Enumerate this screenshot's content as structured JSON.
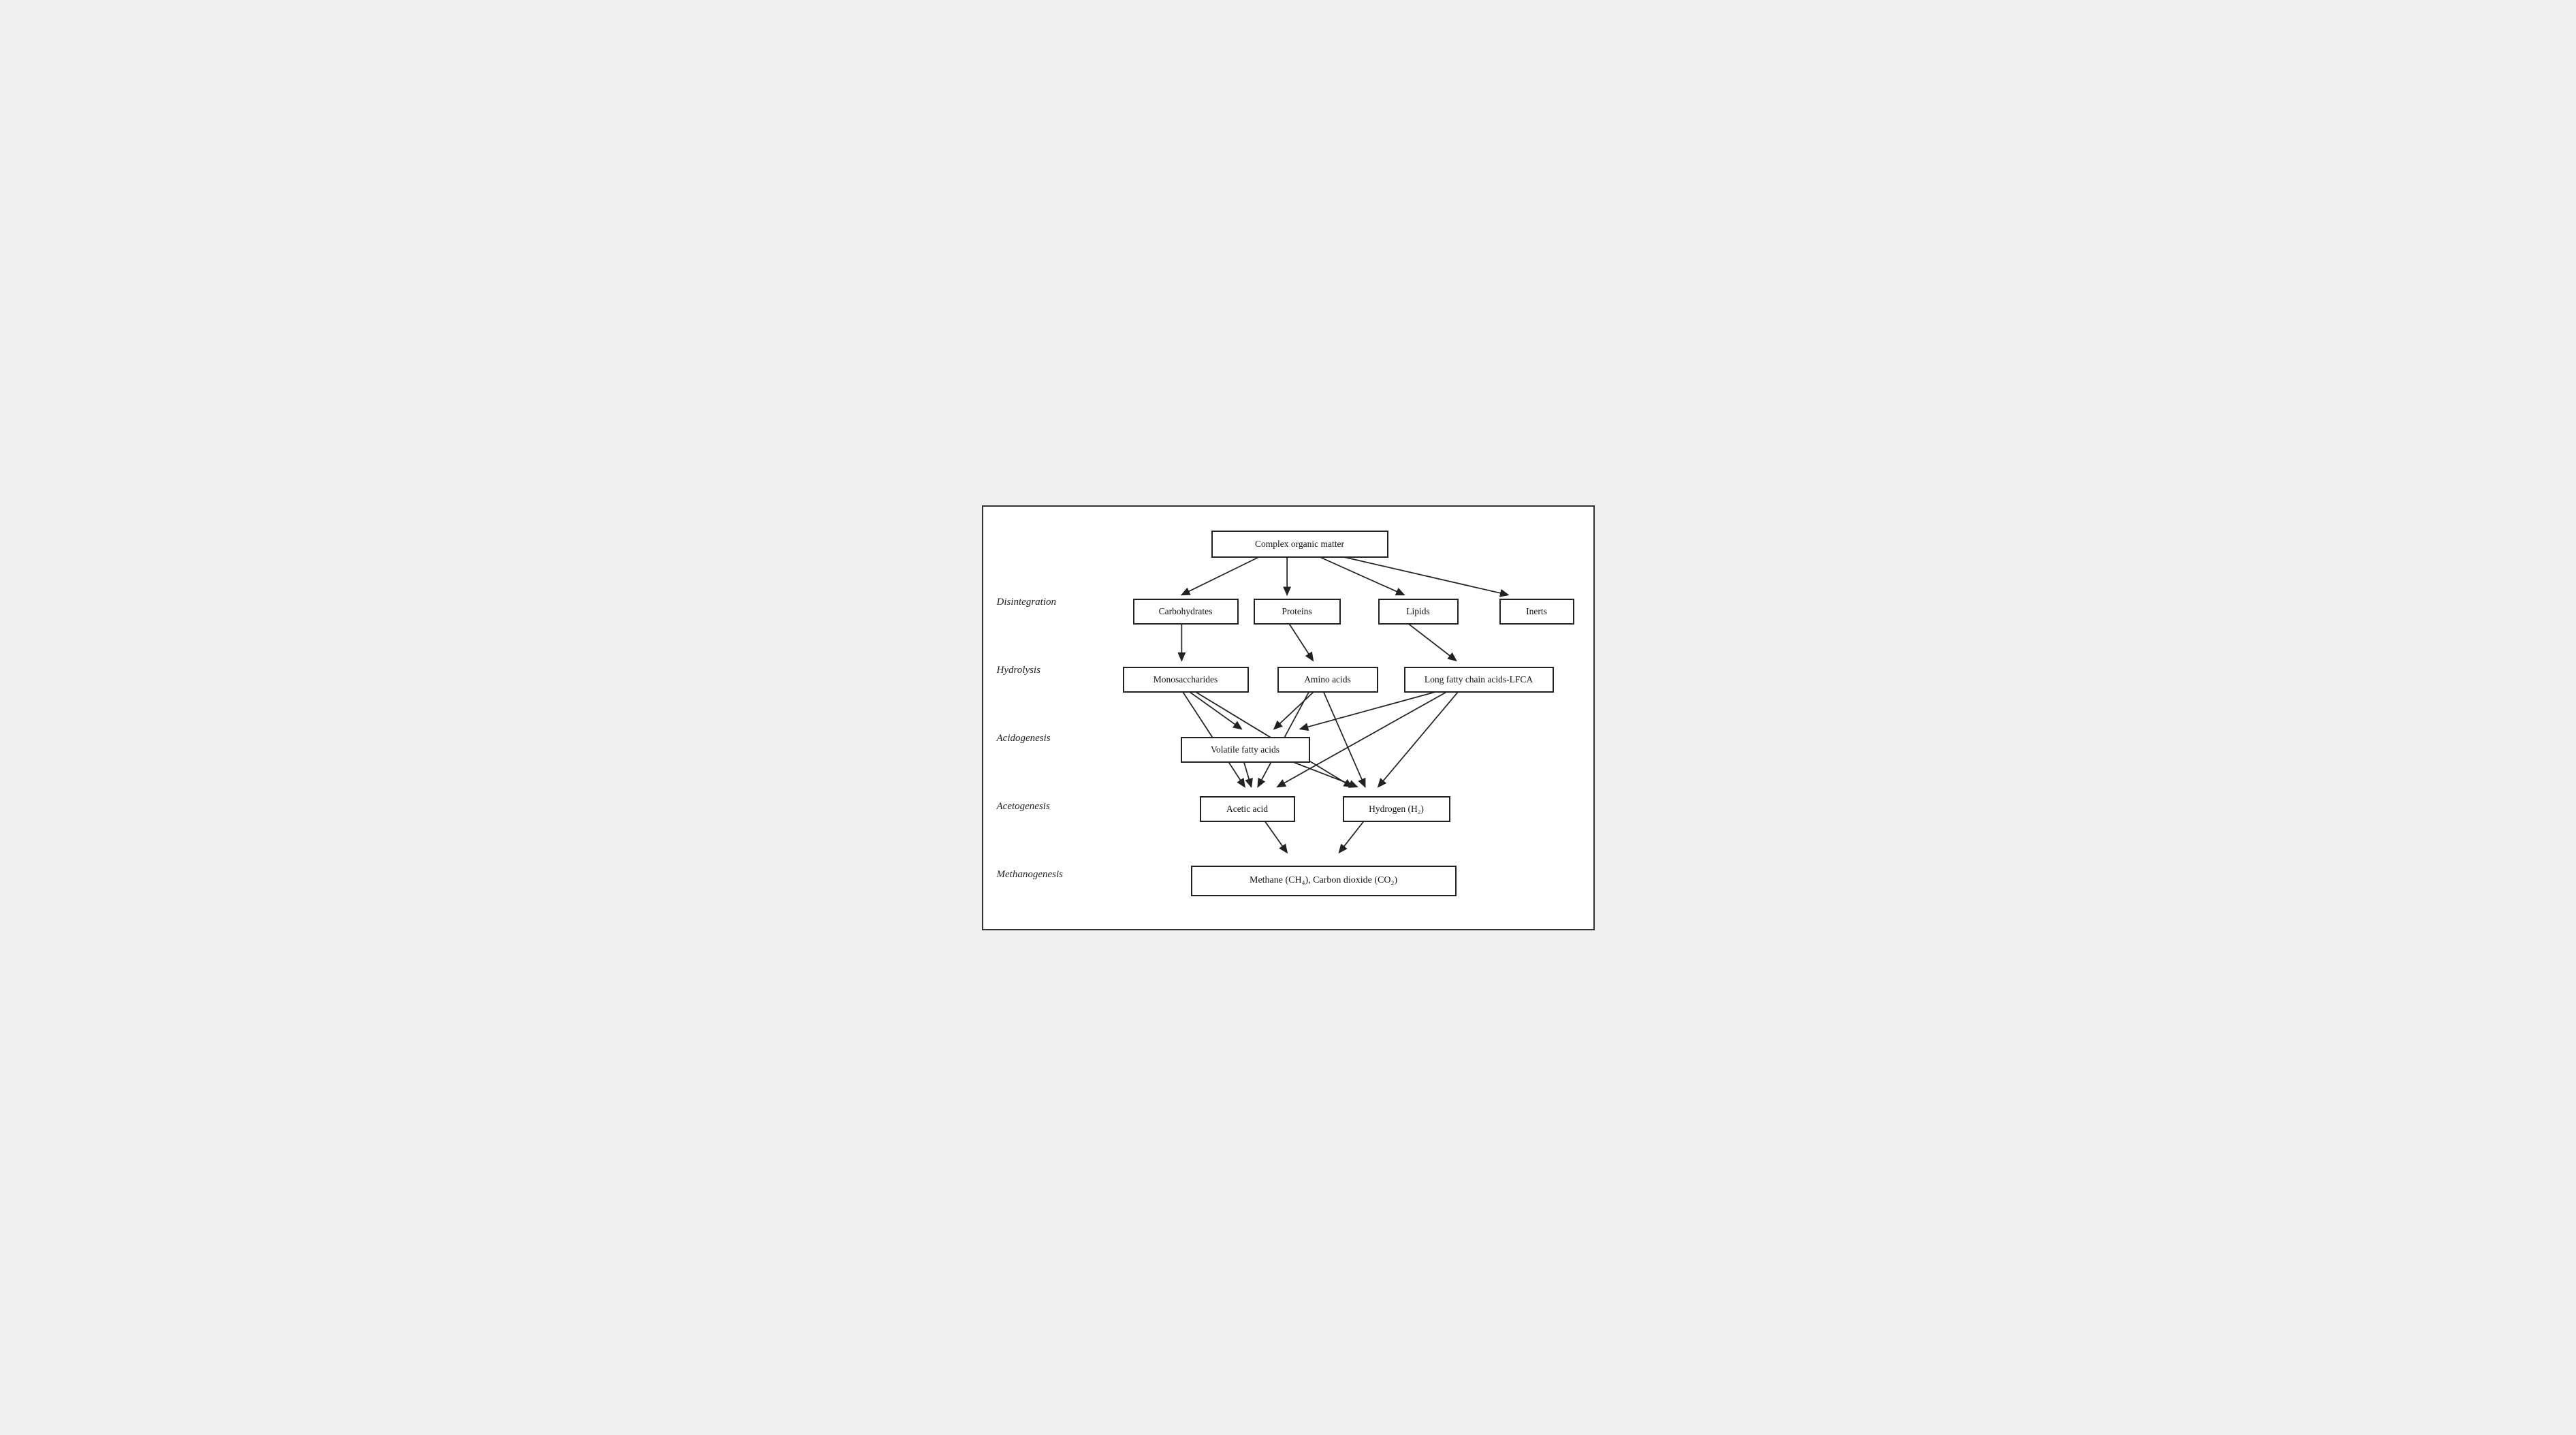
{
  "diagram": {
    "title": "Complex organic matter",
    "stages": [
      {
        "id": "disintegration",
        "label": "Disintegration"
      },
      {
        "id": "hydrolysis",
        "label": "Hydrolysis"
      },
      {
        "id": "acidogenesis",
        "label": "Acidogenesis"
      },
      {
        "id": "acetogenesis",
        "label": "Acetogenesis"
      },
      {
        "id": "methanogenesis",
        "label": "Methanogenesis"
      }
    ],
    "nodes": [
      {
        "id": "complex",
        "label": "Complex organic matter"
      },
      {
        "id": "carbohydrates",
        "label": "Carbohydrates"
      },
      {
        "id": "proteins",
        "label": "Proteins"
      },
      {
        "id": "lipids",
        "label": "Lipids"
      },
      {
        "id": "inerts",
        "label": "Inerts"
      },
      {
        "id": "monosaccharides",
        "label": "Monosaccharides"
      },
      {
        "id": "amino_acids",
        "label": "Amino acids"
      },
      {
        "id": "lfca",
        "label": "Long fatty chain acids-LFCA"
      },
      {
        "id": "volatile_fatty",
        "label": "Volatile fatty acids"
      },
      {
        "id": "acetic_acid",
        "label": "Acetic acid"
      },
      {
        "id": "hydrogen",
        "label": "Hydrogen (H₂)"
      },
      {
        "id": "methane",
        "label": "Methane (CH₄), Carbon dioxide (CO₂)"
      }
    ]
  }
}
